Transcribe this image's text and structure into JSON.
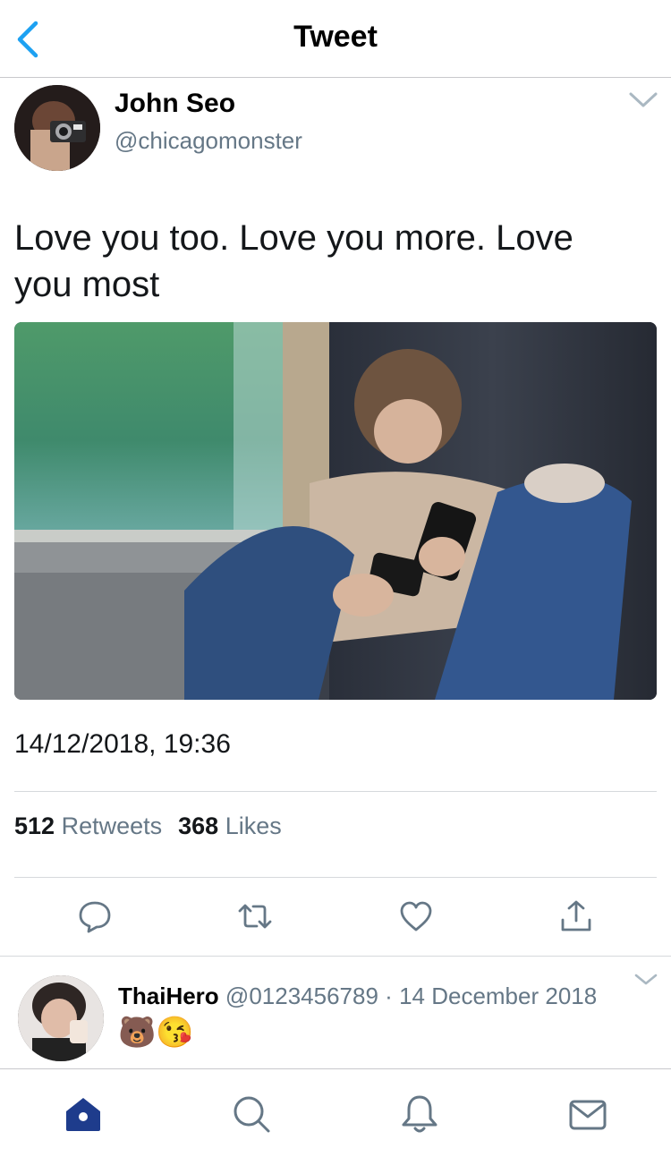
{
  "header": {
    "title": "Tweet"
  },
  "tweet": {
    "author_name": "John Seo",
    "author_handle": "@chicagomonster",
    "text": "Love you too. Love you more. Love you most",
    "timestamp": "14/12/2018, 19:36",
    "retweet_count": "512",
    "retweet_label": "Retweets",
    "like_count": "368",
    "like_label": "Likes"
  },
  "actions": [
    "reply-icon",
    "retweet-icon",
    "like-icon",
    "share-icon"
  ],
  "reply": {
    "name": "ThaiHero",
    "handle": "@0123456789",
    "separator": "·",
    "date": "14 December 2018",
    "text": "🐻😘"
  },
  "tabbar": [
    "home-icon",
    "search-icon",
    "notifications-icon",
    "messages-icon"
  ],
  "colors": {
    "accent": "#1da1f2",
    "tab_active": "#1e3c8c",
    "icon_gray": "#657786"
  }
}
